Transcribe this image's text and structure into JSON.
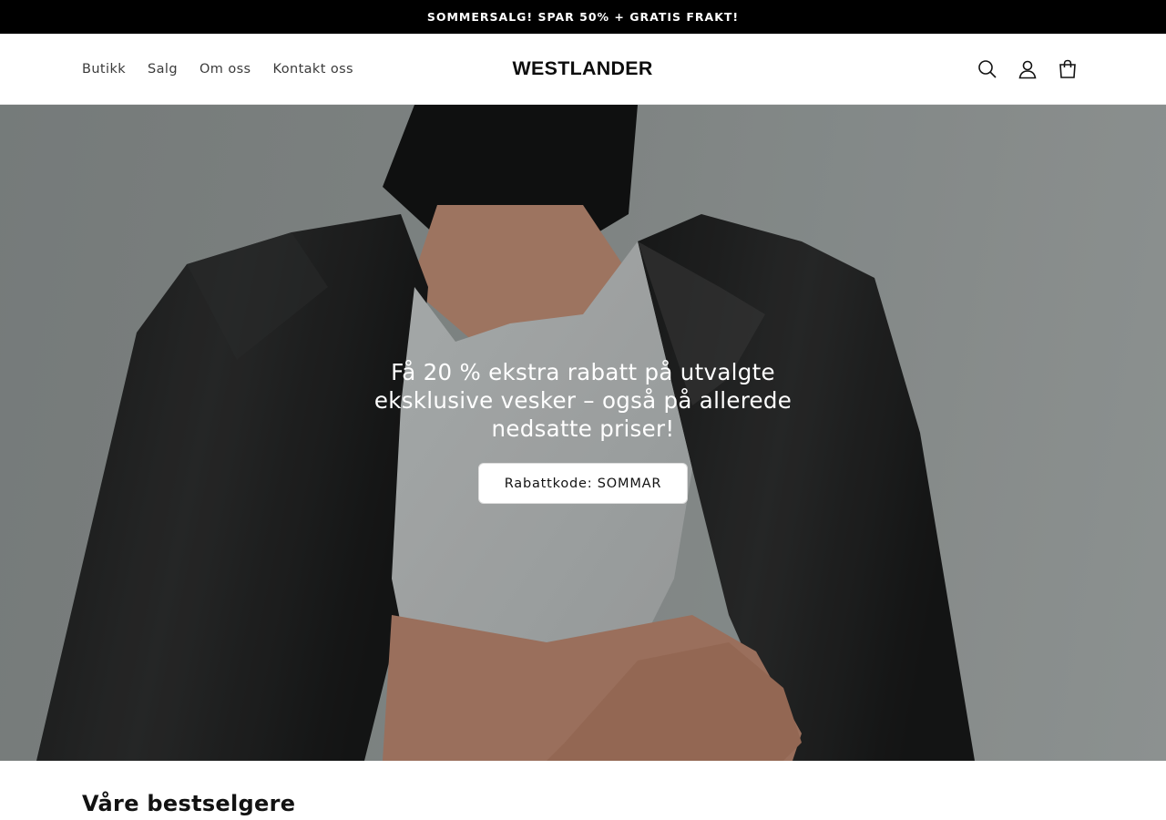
{
  "announcement": "SOMMERSALG! SPAR 50% + GRATIS FRAKT!",
  "header": {
    "nav": [
      "Butikk",
      "Salg",
      "Om oss",
      "Kontakt oss"
    ],
    "logo": "WESTLANDER",
    "icons": [
      "search-icon",
      "account-icon",
      "cart-icon"
    ]
  },
  "hero": {
    "heading": "Få 20 % ekstra rabatt på utvalgte eksklusive vesker – også på allerede nedsatte priser!",
    "button": "Rabattkode: SOMMAR"
  },
  "bestsellers": {
    "title": "Våre bestselgere"
  },
  "colors": {
    "announcement_bg": "#000000",
    "accent": "#121212",
    "hero_button_bg": "#ffffff"
  }
}
